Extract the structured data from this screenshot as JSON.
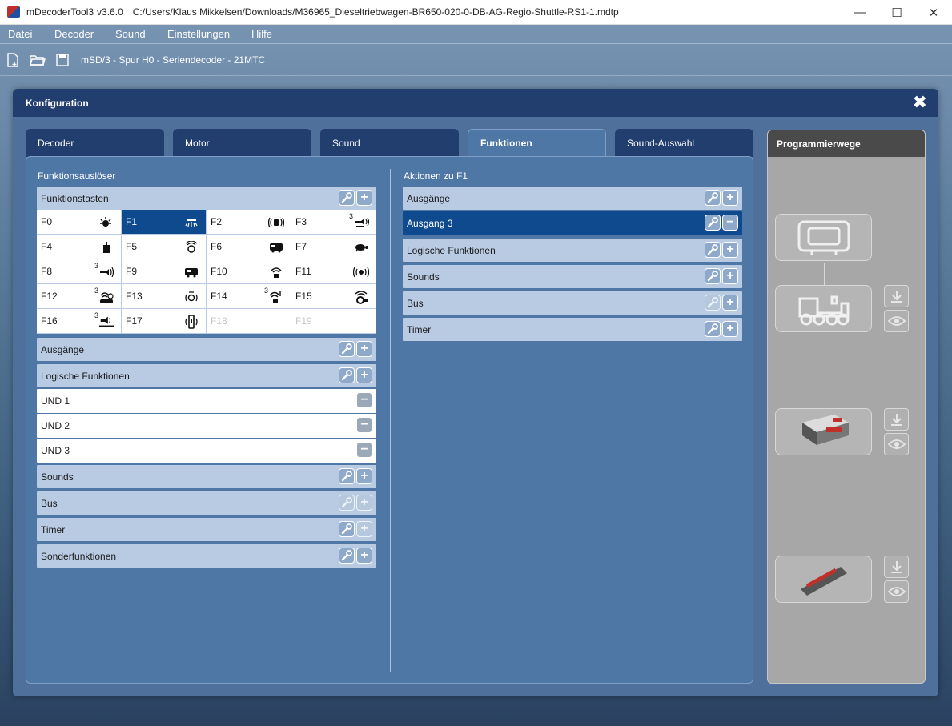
{
  "window": {
    "app_name": "mDecoderTool3",
    "version": "v3.6.0",
    "path": "C:/Users/Klaus Mikkelsen/Downloads/M36965_Dieseltriebwagen-BR650-020-0-DB-AG-Regio-Shuttle-RS1-1.mdtp",
    "controls": [
      "—",
      "☐",
      "✕"
    ]
  },
  "menu": [
    "Datei",
    "Decoder",
    "Sound",
    "Einstellungen",
    "Hilfe"
  ],
  "toolbar": {
    "decoder_label": "mSD/3 - Spur H0 - Seriendecoder - 21MTC"
  },
  "dialog": {
    "title": "Konfiguration",
    "close": "✖",
    "tabs": [
      "Decoder",
      "Motor",
      "Sound",
      "Funktionen",
      "Sound-Auswahl"
    ],
    "active_tab": "Funktionen"
  },
  "left": {
    "title": "Funktionsauslöser",
    "funktionstasten": "Funktionstasten",
    "function_keys": [
      {
        "label": "F0",
        "icon": "light-icon",
        "sup": ""
      },
      {
        "label": "F1",
        "icon": "lamp-icon",
        "sup": ""
      },
      {
        "label": "F2",
        "icon": "sound-icon",
        "sup": ""
      },
      {
        "label": "F3",
        "icon": "horn-icon",
        "sup": "3"
      },
      {
        "label": "F4",
        "icon": "bell-icon",
        "sup": ""
      },
      {
        "label": "F5",
        "icon": "sound-icon",
        "sup": ""
      },
      {
        "label": "F6",
        "icon": "train-icon",
        "sup": ""
      },
      {
        "label": "F7",
        "icon": "turtle-icon",
        "sup": ""
      },
      {
        "label": "F8",
        "icon": "horn-icon",
        "sup": "3"
      },
      {
        "label": "F9",
        "icon": "train-icon",
        "sup": ""
      },
      {
        "label": "F10",
        "icon": "sound-icon",
        "sup": ""
      },
      {
        "label": "F11",
        "icon": "sound-icon",
        "sup": ""
      },
      {
        "label": "F12",
        "icon": "sound-icon",
        "sup": "3"
      },
      {
        "label": "F13",
        "icon": "sound-icon",
        "sup": ""
      },
      {
        "label": "F14",
        "icon": "sound-icon",
        "sup": "3"
      },
      {
        "label": "F15",
        "icon": "sound-icon",
        "sup": ""
      },
      {
        "label": "F16",
        "icon": "sound-icon",
        "sup": "3"
      },
      {
        "label": "F17",
        "icon": "sound-icon",
        "sup": ""
      },
      {
        "label": "F18",
        "icon": "",
        "sup": ""
      },
      {
        "label": "F19",
        "icon": "",
        "sup": ""
      }
    ],
    "ausgaenge": "Ausgänge",
    "logische": "Logische Funktionen",
    "und": [
      "UND 1",
      "UND 2",
      "UND 3"
    ],
    "sounds": "Sounds",
    "bus": "Bus",
    "timer": "Timer",
    "sonder": "Sonderfunktionen"
  },
  "right": {
    "title": "Aktionen zu F1",
    "ausgaenge": "Ausgänge",
    "ausgang3": "Ausgang 3",
    "logische": "Logische Funktionen",
    "sounds": "Sounds",
    "bus": "Bus",
    "timer": "Timer"
  },
  "prog": {
    "title": "Programmierwege"
  },
  "colors": {
    "dialog_header": "#213e6e",
    "panel": "#4e77a6",
    "row": "#b8cbe3",
    "selected": "#0f4a8e"
  }
}
